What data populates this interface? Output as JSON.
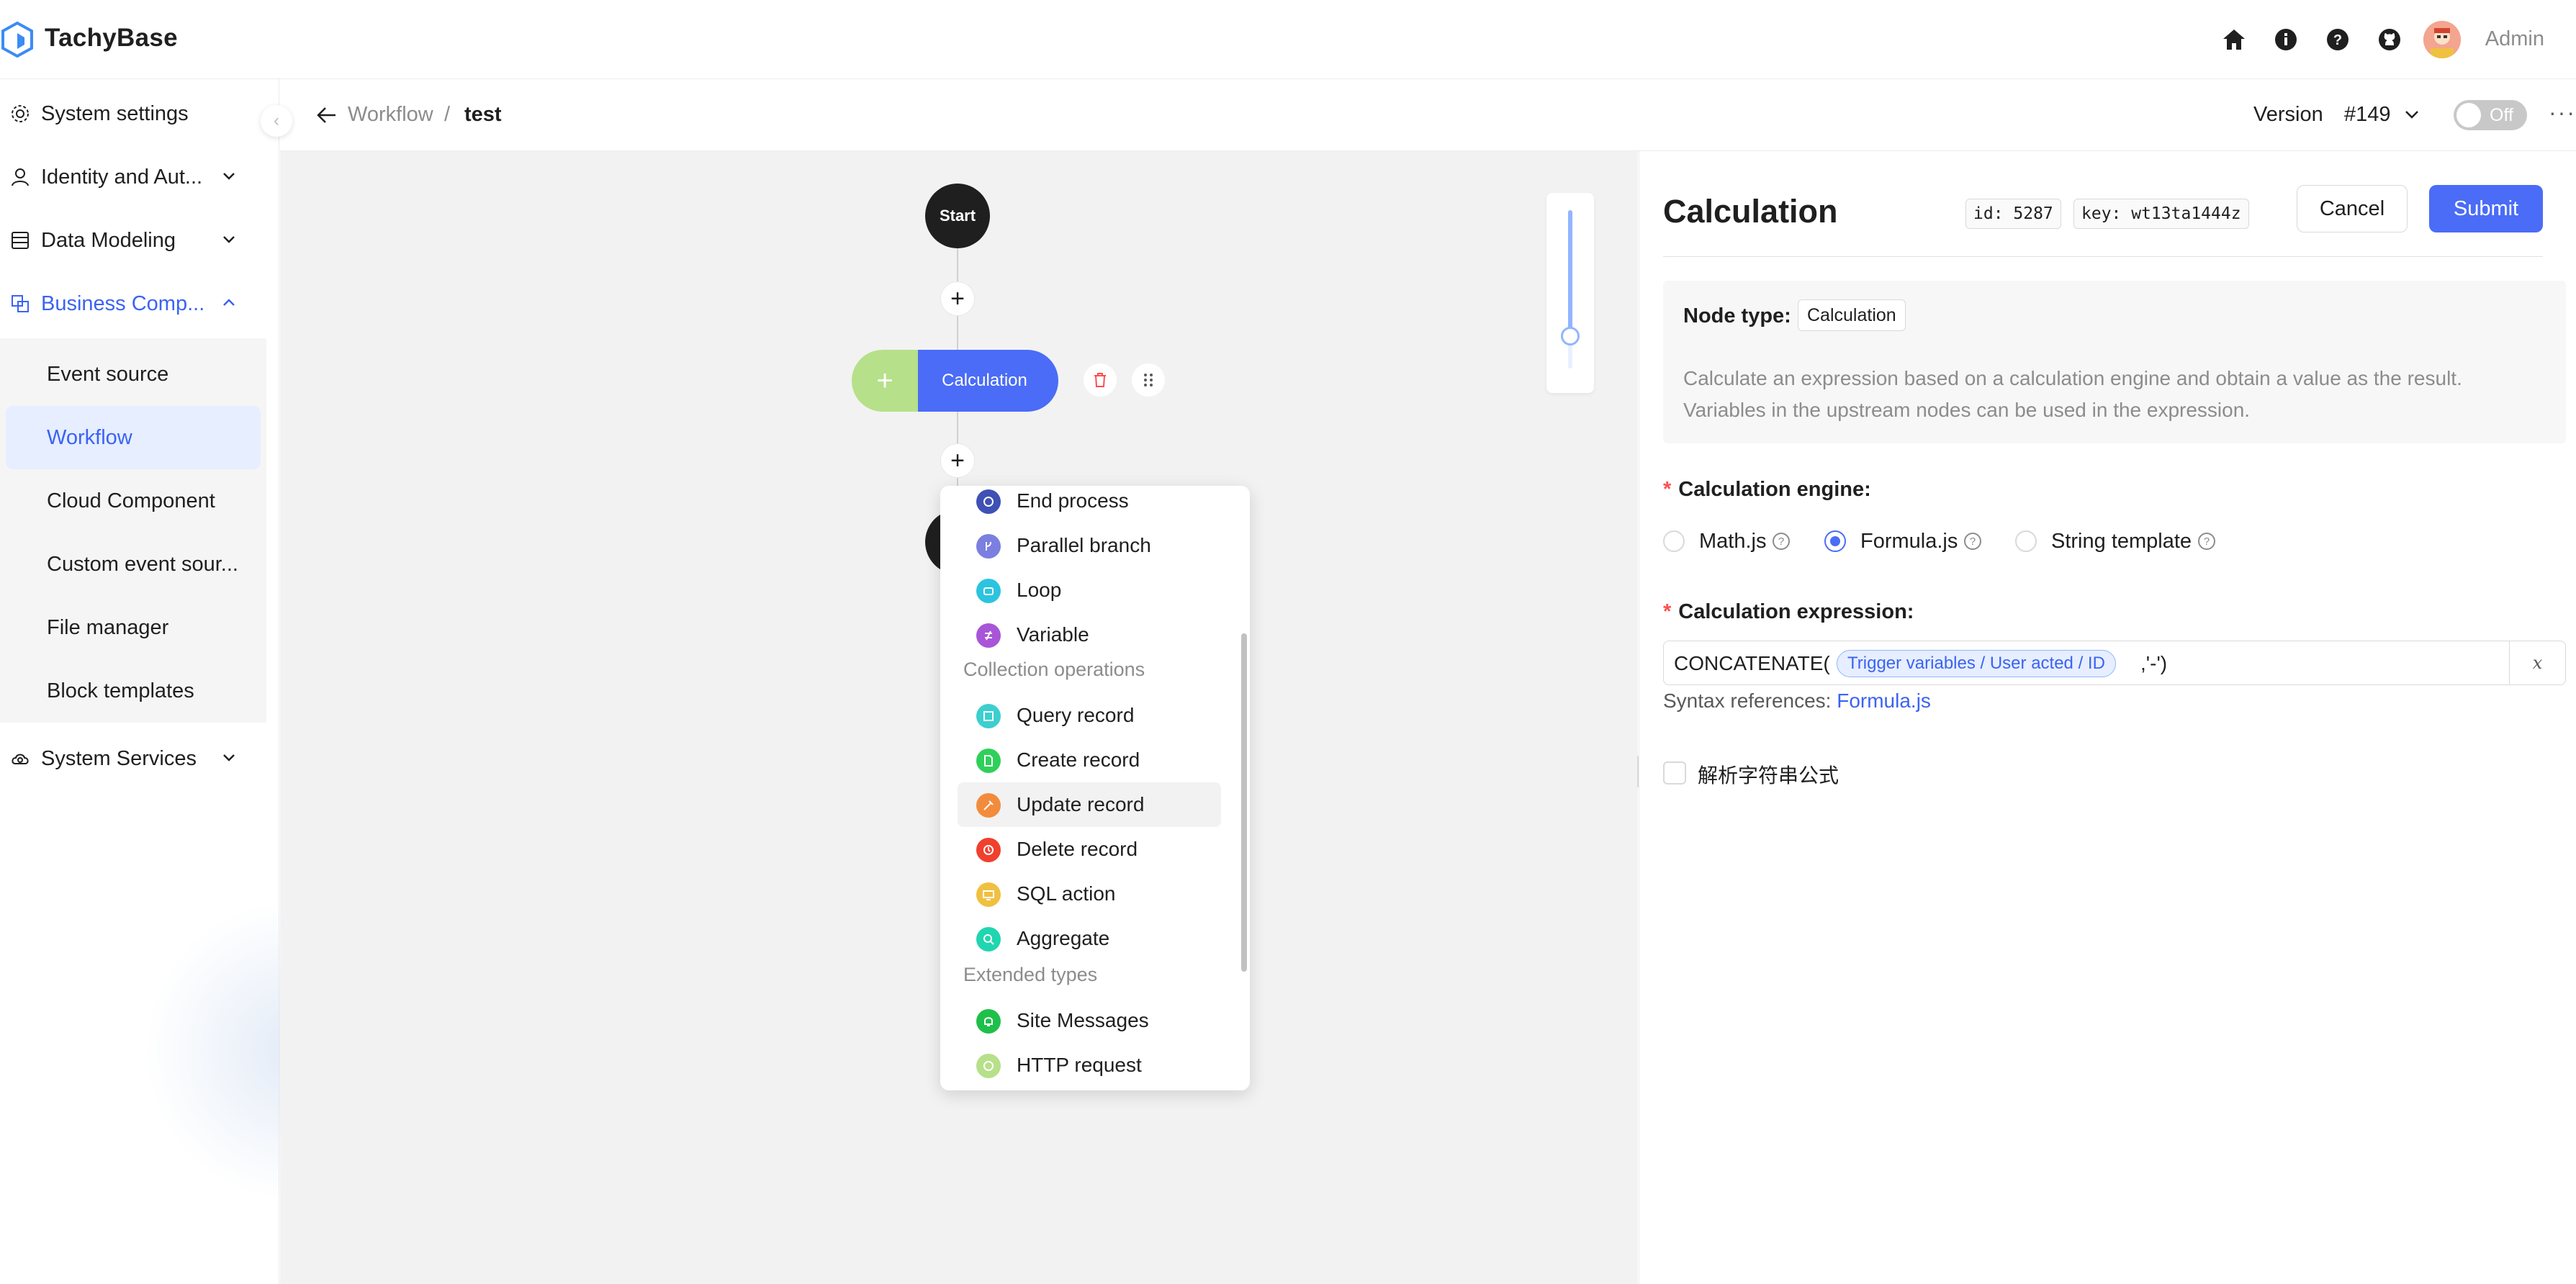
{
  "header": {
    "brand": "TachyBase",
    "user_name": "Admin",
    "icons": [
      "home-icon",
      "info-icon",
      "help-icon",
      "github-icon"
    ]
  },
  "sidebar": {
    "items": [
      {
        "label": "System settings",
        "icon": "gear-icon"
      },
      {
        "label": "Identity and Aut...",
        "icon": "user-icon"
      },
      {
        "label": "Data Modeling",
        "icon": "database-icon"
      },
      {
        "label": "Business Comp...",
        "icon": "blocks-icon"
      },
      {
        "label": "System Services",
        "icon": "cloud-icon"
      }
    ],
    "sub_items": [
      {
        "label": "Event source"
      },
      {
        "label": "Workflow"
      },
      {
        "label": "Cloud Component"
      },
      {
        "label": "Custom event sour..."
      },
      {
        "label": "File manager"
      },
      {
        "label": "Block templates"
      }
    ]
  },
  "topbar": {
    "breadcrumb_parent": "Workflow",
    "breadcrumb_sep": "/",
    "breadcrumb_current": "test",
    "version_label": "Version",
    "version_number": "#149",
    "toggle_label": "Off",
    "more": "···"
  },
  "canvas": {
    "start_label": "Start",
    "calc_node_label": "Calculation",
    "calc_add": "+"
  },
  "dropdown": {
    "items_top": [
      {
        "label": "End process",
        "color": "#3f51b5"
      },
      {
        "label": "Parallel branch",
        "color": "#7b7fe0"
      },
      {
        "label": "Loop",
        "color": "#2bc4e0"
      },
      {
        "label": "Variable",
        "color": "#a855d8"
      }
    ],
    "group_collection": "Collection operations",
    "items_collection": [
      {
        "label": "Query record",
        "color": "#3ccfcf"
      },
      {
        "label": "Create record",
        "color": "#2fd05a"
      },
      {
        "label": "Update record",
        "color": "#f28c3c"
      },
      {
        "label": "Delete record",
        "color": "#f0402e"
      },
      {
        "label": "SQL action",
        "color": "#f0c040"
      },
      {
        "label": "Aggregate",
        "color": "#1fd6b0"
      }
    ],
    "group_extended": "Extended types",
    "items_extended": [
      {
        "label": "Site Messages",
        "color": "#1ec04a"
      },
      {
        "label": "HTTP request",
        "color": "#b7e08a"
      }
    ]
  },
  "panel": {
    "title": "Calculation",
    "id_tag": "id: 5287",
    "key_tag": "key: wt13ta1444z",
    "cancel": "Cancel",
    "submit": "Submit",
    "node_type_label": "Node type:",
    "node_type_value": "Calculation",
    "description_line1": "Calculate an expression based on a calculation engine and obtain a value as the result.",
    "description_line2": "Variables in the upstream nodes can be used in the expression.",
    "engine_label": "Calculation engine",
    "engines": [
      "Math.js",
      "Formula.js",
      "String template"
    ],
    "selected_engine": "Formula.js",
    "expression_label": "Calculation expression",
    "expr_prefix": "CONCATENATE(",
    "expr_variable": "Trigger variables / User acted / ID",
    "expr_suffix": ",'-')",
    "expr_btn": "x",
    "syntax_text": "Syntax references: ",
    "syntax_link": "Formula.js",
    "checkbox_label": "解析字符串公式",
    "accent": "#4a6cf7"
  }
}
